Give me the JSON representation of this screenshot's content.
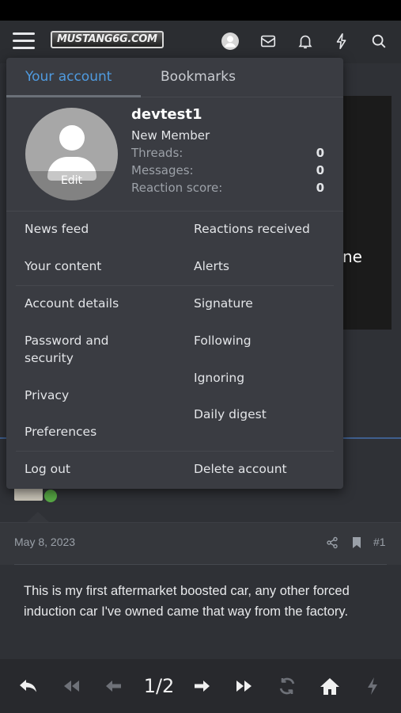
{
  "header": {
    "logo_text": "MUSTANG6G.COM",
    "icons": [
      "menu-icon",
      "avatar-icon",
      "mail-icon",
      "bell-icon",
      "lightning-icon",
      "search-icon"
    ]
  },
  "background": {
    "hero_fragment": "ne",
    "post": {
      "date": "May 8, 2023",
      "number": "#1",
      "body": "This is my first aftermarket boosted car, any other forced induction car I've owned came that way from the factory."
    }
  },
  "account_menu": {
    "tabs": [
      {
        "label": "Your account",
        "active": true
      },
      {
        "label": "Bookmarks",
        "active": false
      }
    ],
    "avatar_edit_label": "Edit",
    "user": {
      "name": "devtest1",
      "title": "New Member",
      "stats": [
        {
          "label": "Threads:",
          "value": "0"
        },
        {
          "label": "Messages:",
          "value": "0"
        },
        {
          "label": "Reaction score:",
          "value": "0"
        }
      ]
    },
    "links_group1": {
      "left": [
        "News feed",
        "Your content"
      ],
      "right": [
        "Reactions received",
        "Alerts"
      ]
    },
    "links_group2": {
      "left": [
        "Account details",
        "Password and security",
        "Privacy",
        "Preferences"
      ],
      "right": [
        "Signature",
        "Following",
        "Ignoring",
        "Daily digest"
      ]
    },
    "footer": {
      "logout": "Log out",
      "delete_account": "Delete account"
    }
  },
  "bottom_nav": {
    "page_indicator": "1/2",
    "icons": [
      "reply-icon",
      "first-page-icon",
      "prev-page-icon",
      "next-page-icon",
      "last-page-icon",
      "refresh-icon",
      "home-icon",
      "lightning-icon"
    ]
  },
  "colors": {
    "accent": "#4f9be0",
    "menu_bg": "#3a3c42",
    "nav_bg": "#2b2d31",
    "online": "#57a845"
  }
}
